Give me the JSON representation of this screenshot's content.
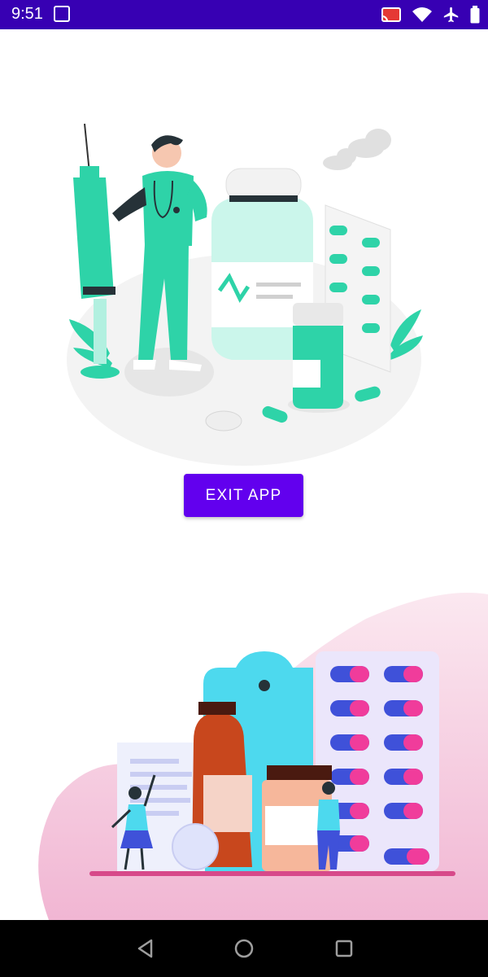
{
  "status_bar": {
    "time": "9:51",
    "background": "#3700b3",
    "icons": [
      "notification-icon",
      "cast-icon",
      "wifi-icon",
      "airplane-mode-icon",
      "battery-icon"
    ]
  },
  "main": {
    "exit_button_label": "EXIT APP",
    "accent": "#6200ee"
  },
  "nav_bar": {
    "buttons": [
      "back",
      "home",
      "recents"
    ]
  }
}
